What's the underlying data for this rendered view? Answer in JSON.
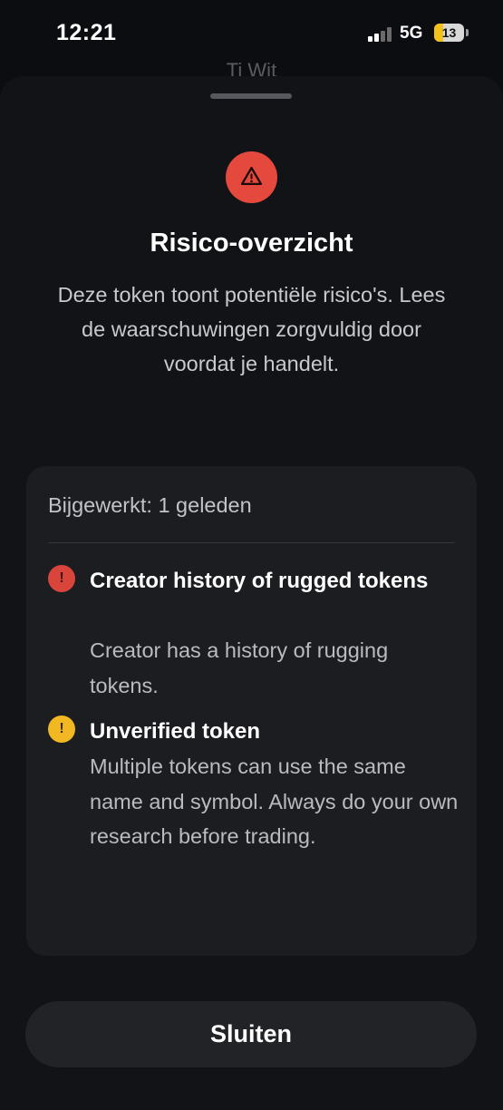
{
  "status_bar": {
    "time": "12:21",
    "network": "5G",
    "battery": "13",
    "battery_level_percent": 13
  },
  "background_title": "Ti Wit",
  "sheet": {
    "title": "Risico-overzicht",
    "description": "Deze token toont potentiële risico's. Lees de waarschuwingen zorgvuldig door voordat je handelt.",
    "warning_icon": "warning-triangle-icon",
    "card": {
      "updated": "Bijgewerkt: 1 geleden",
      "risks": [
        {
          "severity": "high",
          "icon": "exclamation-icon",
          "color": "#d9453b",
          "glyph": "!",
          "title": "Creator history of rugged tokens",
          "description": "Creator has a history of rugging tokens."
        },
        {
          "severity": "medium",
          "icon": "exclamation-icon",
          "color": "#f2b824",
          "glyph": "!",
          "title": "Unverified token",
          "description": "Multiple tokens can use the same name and symbol. Always do your own research before trading."
        }
      ]
    },
    "close_label": "Sluiten"
  },
  "colors": {
    "background": "#0c0d10",
    "sheet": "#121316",
    "card": "#1c1d21",
    "danger": "#e5493e",
    "warning": "#f2b824"
  }
}
